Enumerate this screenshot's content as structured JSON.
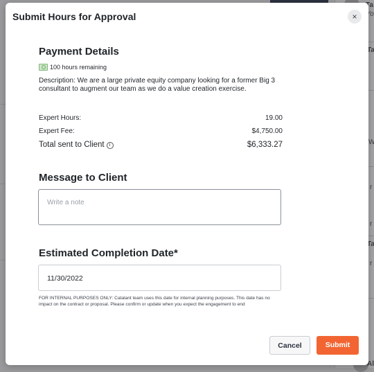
{
  "background": {
    "side_texts": [
      "Ta",
      "Yo",
      "Ta",
      "Ta",
      "r",
      "r",
      "r",
      "W",
      "Al"
    ]
  },
  "modal": {
    "title": "Submit Hours for Approval",
    "close_icon": "×",
    "payment": {
      "heading": "Payment Details",
      "hours_remaining": "100 hours remaining",
      "hours_icon": "money-icon",
      "description": "Description: We are a large private equity company looking for a former Big 3 consultant to augment our team as we do a value creation exercise.",
      "rows": [
        {
          "label": "Expert Hours:",
          "value": "19.00"
        },
        {
          "label": "Expert Fee:",
          "value": "$4,750.00"
        }
      ],
      "total": {
        "label": "Total sent to Client",
        "value": "$6,333.27",
        "info_icon": "ⓘ"
      }
    },
    "message": {
      "heading": "Message to Client",
      "placeholder": "Write a note"
    },
    "completion": {
      "heading": "Estimated Completion Date*",
      "date_value": "11/30/2022",
      "note": "FOR INTERNAL PURPOSES ONLY: Catalant team uses this date for internal planning purposes. This date has no impact on the contract or proposal. Please confirm or update when you expect the engagement to end"
    },
    "actions": {
      "cancel_label": "Cancel",
      "submit_label": "Submit"
    }
  },
  "colors": {
    "submit": "#f26532",
    "overlay": "#9b9b9e"
  }
}
